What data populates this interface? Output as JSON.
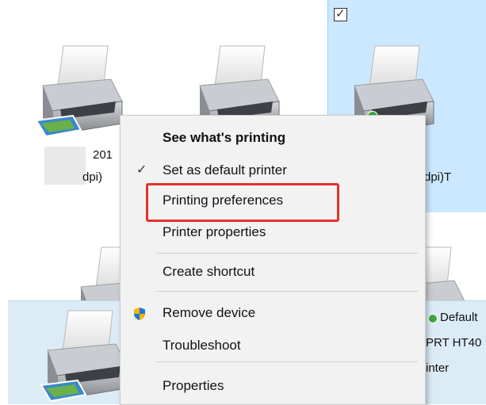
{
  "printers": [
    {
      "caption_line1": "201",
      "caption_line2": "dpi)"
    },
    {
      "caption_line1": "",
      "caption_line2": ""
    },
    {
      "caption_line1": "",
      "caption_line2": "dpi)T"
    }
  ],
  "details": {
    "default_text": "Default",
    "model_text": "PRT HT40",
    "type_text": "inter"
  },
  "context_menu": {
    "items": [
      {
        "label": "See what's printing",
        "bold": true
      },
      {
        "label": "Set as default printer",
        "checked": true
      },
      {
        "label": "Printing preferences",
        "highlighted": true
      },
      {
        "label": "Printer properties"
      },
      {
        "label": "Create shortcut"
      },
      {
        "label": "Remove device",
        "icon": "uac-shield-icon"
      },
      {
        "label": "Troubleshoot"
      },
      {
        "label": "Properties"
      }
    ]
  },
  "colors": {
    "selection": "#cce8ff",
    "menu_bg": "#f2f2f2",
    "highlight_border": "#e4322b",
    "details_strip": "#dcecf7"
  }
}
